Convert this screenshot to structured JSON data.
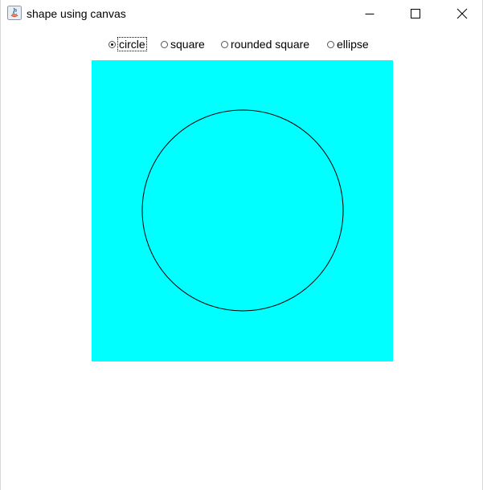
{
  "window": {
    "title": "shape using canvas",
    "app_icon": "java-icon"
  },
  "window_controls": {
    "minimize_icon": "minimize-icon",
    "maximize_icon": "maximize-icon",
    "close_icon": "close-icon"
  },
  "shape_options": [
    {
      "label": "circle",
      "selected": true
    },
    {
      "label": "square",
      "selected": false
    },
    {
      "label": "rounded square",
      "selected": false
    },
    {
      "label": "ellipse",
      "selected": false
    }
  ],
  "canvas": {
    "background_color": "#00ffff",
    "shape": "circle",
    "stroke_color": "#000000"
  }
}
